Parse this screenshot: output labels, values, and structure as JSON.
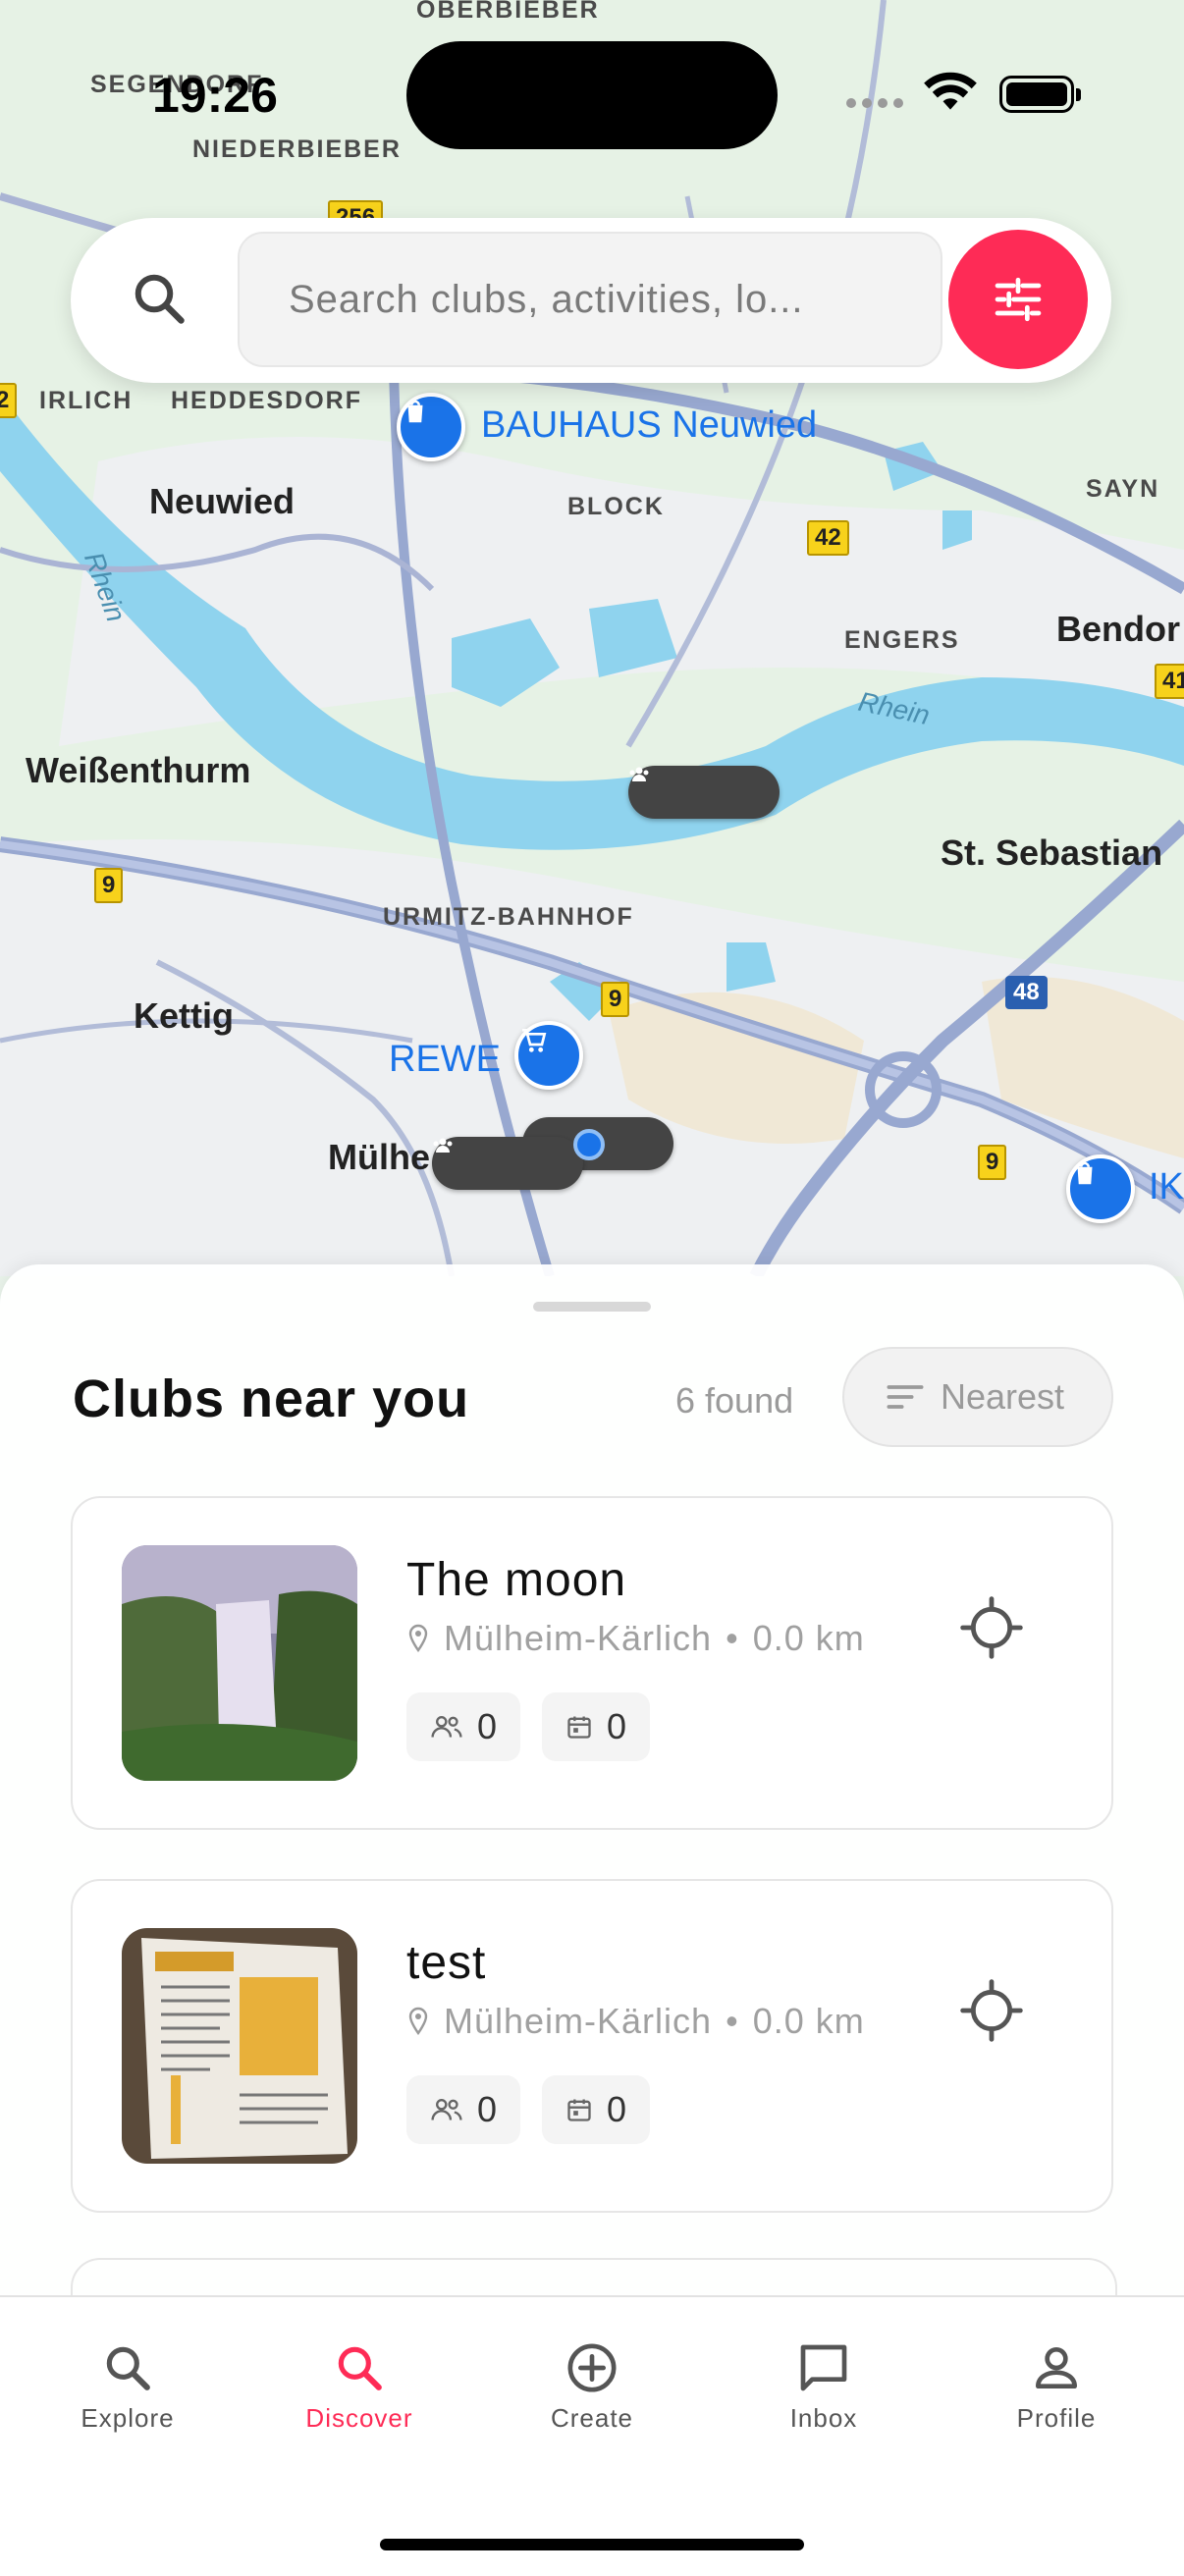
{
  "status_bar": {
    "time": "19:26"
  },
  "map": {
    "places_small": [
      "OBERBIEBER",
      "SEGENDORF",
      "NIEDERBIEBER",
      "IRLICH",
      "HEDDESDORF",
      "BLOCK",
      "ENGERS",
      "SAYN",
      "URMITZ-BAHNHOF"
    ],
    "places_city": [
      "Neuwied",
      "Bendor",
      "Weißenthurm",
      "St. Sebastian",
      "Kettig",
      "Mülhe"
    ],
    "rivers": [
      "Rhein",
      "Rhein"
    ],
    "pois": [
      "BAUHAUS Neuwied",
      "REWE",
      "IK"
    ],
    "road_shields": [
      "2",
      "42",
      "41",
      "9",
      "9",
      "9",
      "48",
      "256"
    ]
  },
  "search": {
    "placeholder": "Search clubs, activities, lo..."
  },
  "sheet": {
    "title": "Clubs near you",
    "found": "6 found",
    "sort_label": "Nearest"
  },
  "clubs": [
    {
      "name": "The moon",
      "location": "Mülheim-Kärlich",
      "distance": "0.0 km",
      "members": "0",
      "events": "0"
    },
    {
      "name": "test",
      "location": "Mülheim-Kärlich",
      "distance": "0.0 km",
      "members": "0",
      "events": "0"
    }
  ],
  "tabs": [
    {
      "label": "Explore",
      "icon": "search-icon",
      "active": false
    },
    {
      "label": "Discover",
      "icon": "search-icon",
      "active": true
    },
    {
      "label": "Create",
      "icon": "plus-circle-icon",
      "active": false
    },
    {
      "label": "Inbox",
      "icon": "chat-bubble-icon",
      "active": false
    },
    {
      "label": "Profile",
      "icon": "person-icon",
      "active": false
    }
  ],
  "colors": {
    "accent": "#fe2b56",
    "map_water": "#8fd3ee",
    "poi_blue": "#1a73e8"
  }
}
